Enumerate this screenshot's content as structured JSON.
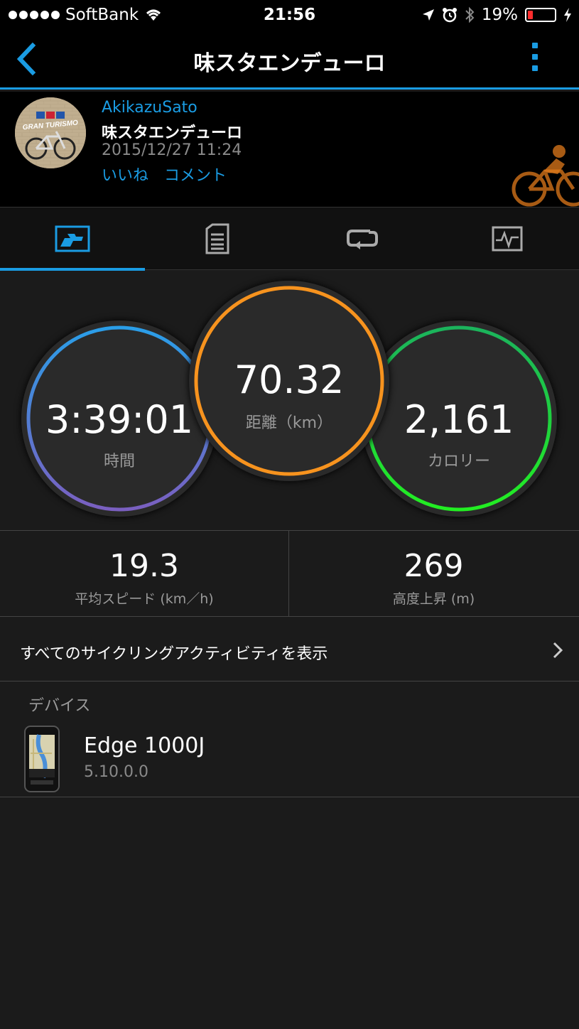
{
  "status_bar": {
    "carrier": "SoftBank",
    "time": "21:56",
    "battery": "19%",
    "battery_level": 0.19
  },
  "nav": {
    "title": "味スタエンデューロ",
    "back_icon": "chevron-left-icon",
    "menu_icon": "more-vertical-icon"
  },
  "activity": {
    "user_name": "AkikazuSato",
    "activity_name": "味スタエンデューロ",
    "datetime": "2015/12/27 11:24",
    "like_label": "いいね",
    "comment_label": "コメント",
    "type_icon": "cycling-icon"
  },
  "tabs": [
    {
      "icon": "overview-icon",
      "active": true
    },
    {
      "icon": "details-icon",
      "active": false
    },
    {
      "icon": "laps-icon",
      "active": false
    },
    {
      "icon": "chart-icon",
      "active": false
    }
  ],
  "rings": {
    "time": {
      "value": "3:39:01",
      "label": "時間"
    },
    "distance": {
      "value": "70.32",
      "label": "距離（km）"
    },
    "calories": {
      "value": "2,161",
      "label": "カロリー"
    }
  },
  "stats": {
    "avg_speed": {
      "value": "19.3",
      "label": "平均スピード (km／h)"
    },
    "elevation": {
      "value": "269",
      "label": "高度上昇 (m)"
    }
  },
  "all_activities_label": "すべてのサイクリングアクティビティを表示",
  "devices": {
    "header": "デバイス",
    "name": "Edge 1000J",
    "version": "5.10.0.0"
  },
  "colors": {
    "accent": "#1a9ce3",
    "distance_ring": "#f7931e",
    "calorie_ring": "#1fdc3a"
  }
}
